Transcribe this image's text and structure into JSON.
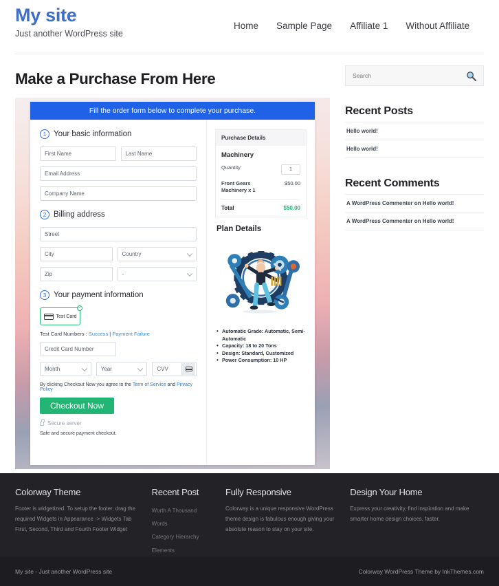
{
  "header": {
    "brand_title": "My site",
    "brand_tagline": "Just another WordPress site",
    "nav": [
      {
        "label": "Home"
      },
      {
        "label": "Sample Page"
      },
      {
        "label": "Affiliate 1"
      },
      {
        "label": "Without Affiliate"
      }
    ]
  },
  "main": {
    "page_title": "Make a Purchase From Here",
    "banner": "Fill the order form below to complete your purchase.",
    "step1": {
      "number": "1",
      "title": "Your basic information",
      "first_name_placeholder": "First Name",
      "last_name_placeholder": "Last Name",
      "email_placeholder": "Email Address",
      "company_placeholder": "Company Name"
    },
    "step2": {
      "number": "2",
      "title": "Billing address",
      "street_placeholder": "Street",
      "city_placeholder": "City",
      "country_placeholder": "Country",
      "zip_placeholder": "Zip",
      "state_placeholder": "-"
    },
    "step3": {
      "number": "3",
      "title": "Your payment information",
      "test_card_label": "Test  Card",
      "test_card_checked": "✓",
      "test_numbers_prefix": "Test Card Numbers : ",
      "test_success_link": "Success",
      "test_separator": " | ",
      "test_failure_link": "Payment Failure",
      "card_number_placeholder": "Credit Card Number",
      "month_placeholder": "Month",
      "year_placeholder": "Year",
      "cvv_placeholder": "CVV",
      "terms_prefix": "By clicking Checkout Now you agree to the ",
      "terms_link1": "Term of Service",
      "terms_mid": " and ",
      "terms_link2": "Privacy Policy",
      "checkout_button": "Checkout Now",
      "secure_server": "Secure server",
      "safe_note": "Safe and secure payment checkout."
    },
    "purchase_details": {
      "heading": "Purchase Details",
      "product": "Machinery",
      "quantity_label": "Quantity",
      "quantity_value": "1",
      "line_item": "Front Gears Machinery x 1",
      "line_price": "$50.00",
      "total_label": "Total",
      "total_value": "$50.00"
    },
    "plan_details": {
      "heading": "Plan Details",
      "features": [
        "Automatic Grade: Automatic, Semi-Automatic",
        "Capacity: 18 to 20 Tons",
        "Design: Standard, Customized",
        "Power Consumption: 10 HP"
      ]
    }
  },
  "sidebar": {
    "search_placeholder": "Search",
    "search_value": "",
    "recent_posts_title": "Recent Posts",
    "recent_posts": [
      {
        "label": "Hello world!"
      },
      {
        "label": "Hello world!"
      }
    ],
    "recent_comments_title": "Recent Comments",
    "recent_comments": [
      {
        "label": "A WordPress Commenter on Hello world!"
      },
      {
        "label": "A WordPress Commenter on Hello world!"
      }
    ]
  },
  "footer": {
    "columns": [
      {
        "title": "Colorway Theme",
        "text": "Footer is widgetized. To setup the footer, drag the required Widgets in Appearance -> Widgets Tab First, Second, Third and Fourth Footer Widget"
      },
      {
        "title": "Recent Post",
        "items": [
          {
            "label": "Worth A Thousand Words"
          },
          {
            "label": "Category Hierarchy"
          },
          {
            "label": "Elements"
          }
        ]
      },
      {
        "title": "Fully Responsive",
        "text": "Colorway is a unique responsive WordPress theme design is fabulous enough giving your absolute reason to stay on your site."
      },
      {
        "title": "Design Your Home",
        "text": "Express your creativity, find inspiration and make smarter home design choices, faster."
      }
    ],
    "bar_left": "My site - Just another WordPress site",
    "bar_right": "Colorway WordPress Theme by InkThemes.com"
  },
  "colors": {
    "brand_blue": "#3f6ec6",
    "banner_blue": "#1f62e8",
    "accent_green": "#22b573",
    "footer_dark": "#232327"
  }
}
